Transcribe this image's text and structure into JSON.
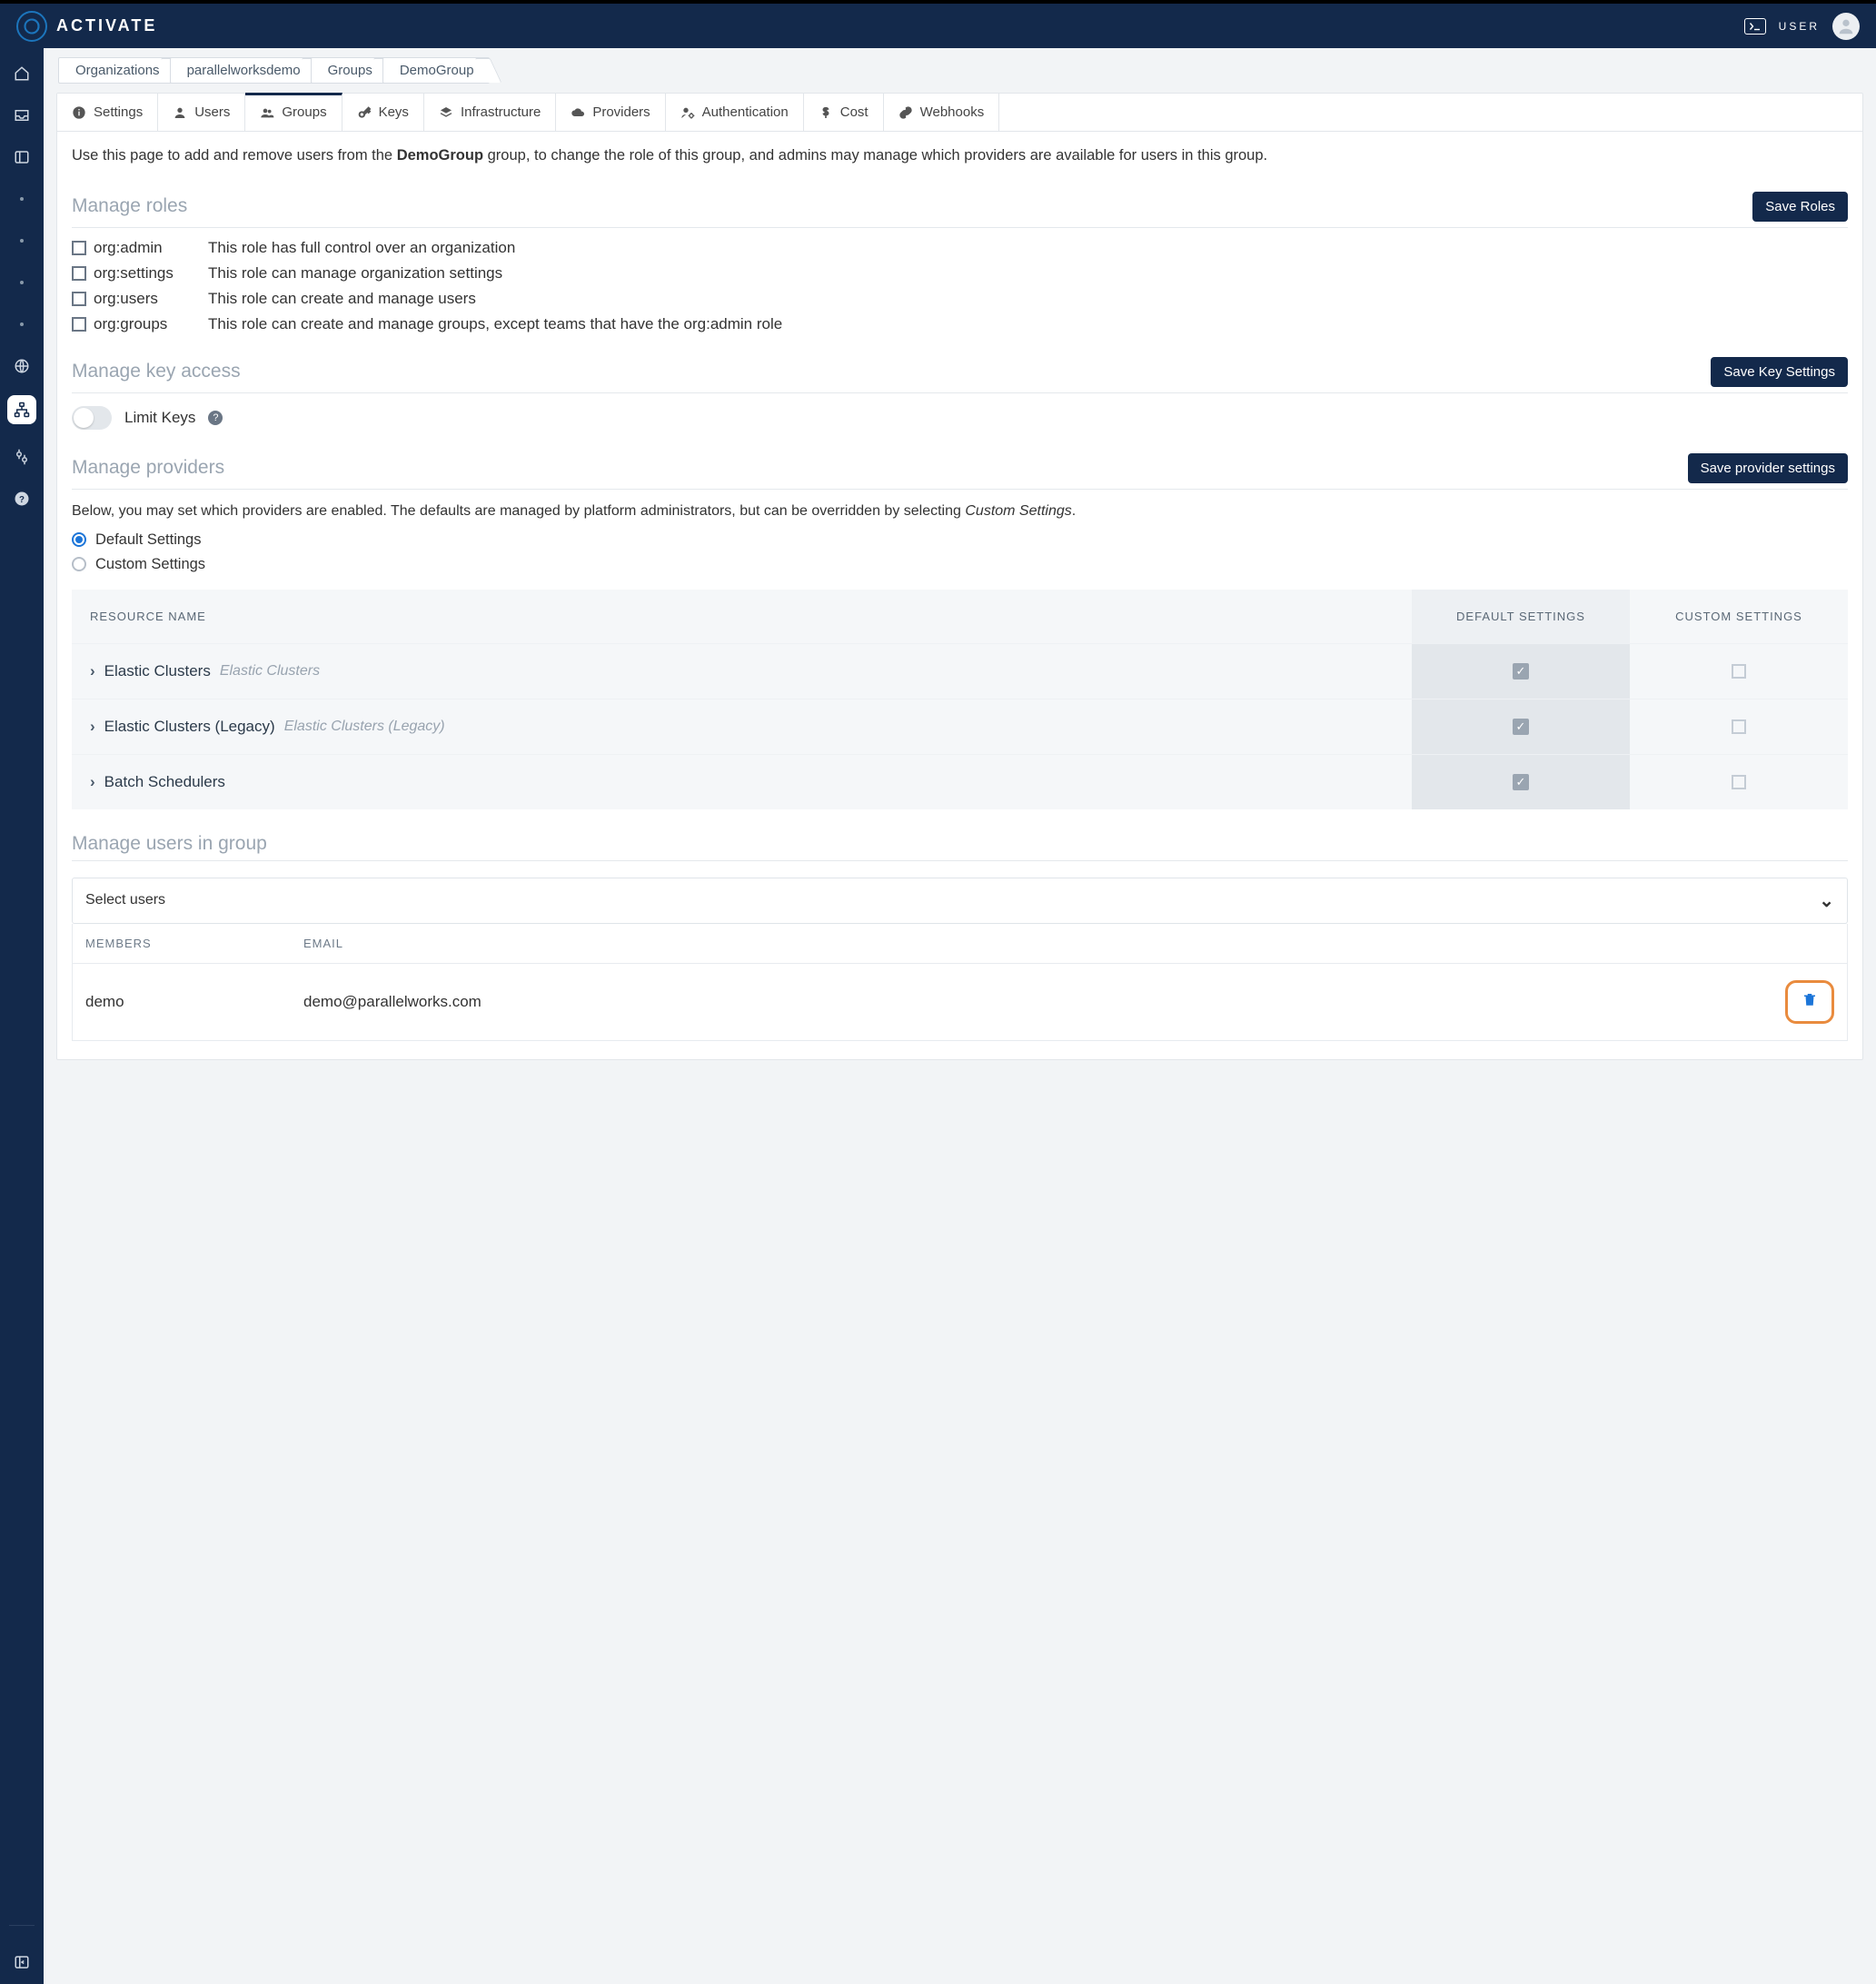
{
  "brand": "ACTIVATE",
  "topbar": {
    "user_label": "USER"
  },
  "breadcrumb": [
    "Organizations",
    "parallelworksdemo",
    "Groups",
    "DemoGroup"
  ],
  "tabs": [
    {
      "id": "settings",
      "label": "Settings"
    },
    {
      "id": "users",
      "label": "Users"
    },
    {
      "id": "groups",
      "label": "Groups",
      "active": true
    },
    {
      "id": "keys",
      "label": "Keys"
    },
    {
      "id": "infrastructure",
      "label": "Infrastructure"
    },
    {
      "id": "providers",
      "label": "Providers"
    },
    {
      "id": "authentication",
      "label": "Authentication"
    },
    {
      "id": "cost",
      "label": "Cost"
    },
    {
      "id": "webhooks",
      "label": "Webhooks"
    }
  ],
  "intro": {
    "pre": "Use this page to add and remove users from the ",
    "group": "DemoGroup",
    "post": " group, to change the role of this group, and admins may manage which providers are available for users in this group."
  },
  "roles_section": {
    "title": "Manage roles",
    "save": "Save Roles",
    "roles": [
      {
        "key": "org:admin",
        "desc": "This role has full control over an organization"
      },
      {
        "key": "org:settings",
        "desc": "This role can manage organization settings"
      },
      {
        "key": "org:users",
        "desc": "This role can create and manage users"
      },
      {
        "key": "org:groups",
        "desc": "This role can create and manage groups, except teams that have the org:admin role"
      }
    ]
  },
  "keys_section": {
    "title": "Manage key access",
    "save": "Save Key Settings",
    "limit_label": "Limit Keys"
  },
  "providers_section": {
    "title": "Manage providers",
    "save": "Save provider settings",
    "desc_pre": "Below, you may set which providers are enabled. The defaults are managed by platform administrators, but can be overridden by selecting ",
    "desc_em": "Custom Settings",
    "desc_post": ".",
    "radio_default": "Default Settings",
    "radio_custom": "Custom Settings",
    "col_resource": "RESOURCE NAME",
    "col_default": "DEFAULT SETTINGS",
    "col_custom": "CUSTOM SETTINGS",
    "rows": [
      {
        "name": "Elastic Clusters",
        "hint": "Elastic Clusters",
        "default": true,
        "custom": false
      },
      {
        "name": "Elastic Clusters (Legacy)",
        "hint": "Elastic Clusters (Legacy)",
        "default": true,
        "custom": false
      },
      {
        "name": "Batch Schedulers",
        "hint": "",
        "default": true,
        "custom": false
      }
    ]
  },
  "users_section": {
    "title": "Manage users in group",
    "select_placeholder": "Select users",
    "col_members": "MEMBERS",
    "col_email": "EMAIL",
    "members": [
      {
        "name": "demo",
        "email": "demo@parallelworks.com"
      }
    ]
  }
}
